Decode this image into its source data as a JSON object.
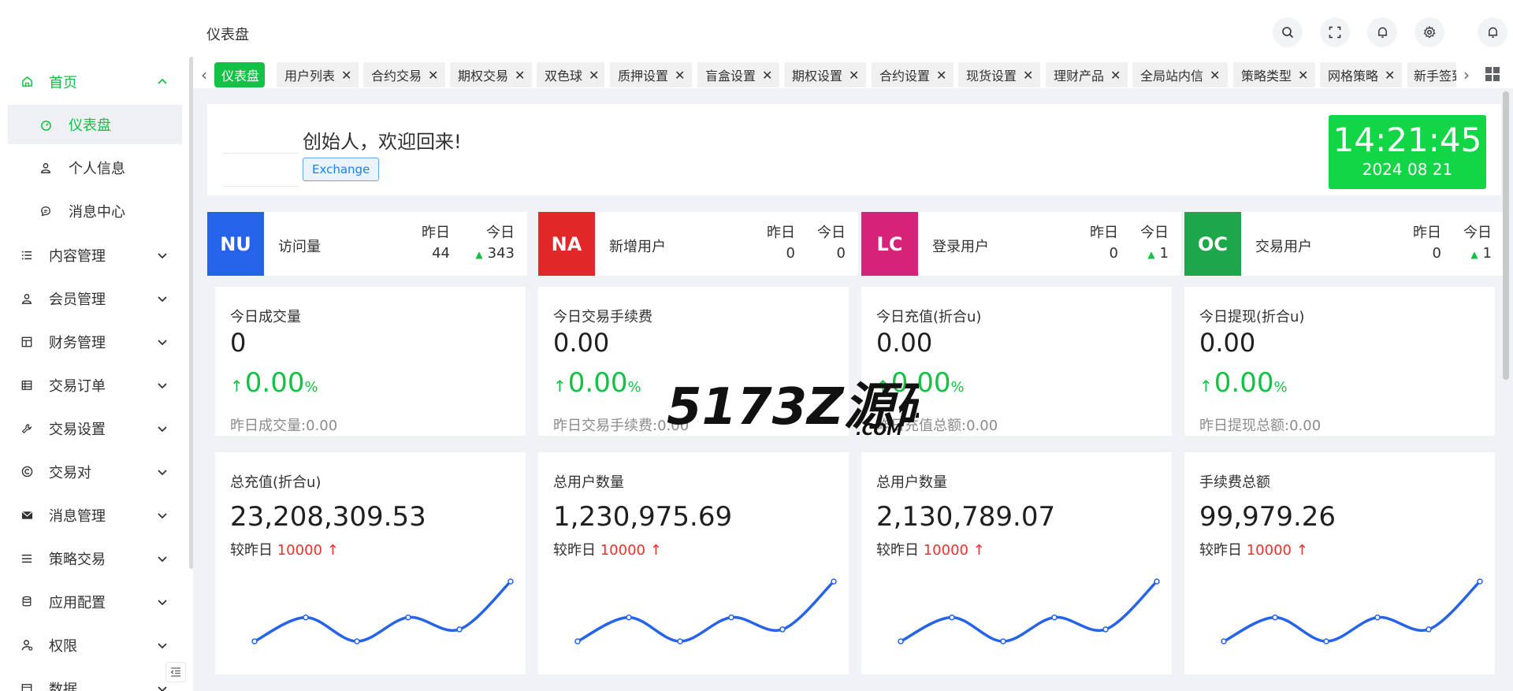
{
  "header": {
    "page_title": "仪表盘"
  },
  "sidebar": {
    "home": "首页",
    "home_children": [
      "仪表盘",
      "个人信息",
      "消息中心"
    ],
    "menus": [
      "内容管理",
      "会员管理",
      "财务管理",
      "交易订单",
      "交易设置",
      "交易对",
      "消息管理",
      "策略交易",
      "应用配置",
      "权限",
      "数据"
    ]
  },
  "tabs": [
    "仪表盘",
    "用户列表",
    "合约交易",
    "期权交易",
    "双色球",
    "质押设置",
    "盲盒设置",
    "期权设置",
    "合约设置",
    "现货设置",
    "理财产品",
    "全局站内信",
    "策略类型",
    "网格策略",
    "新手签到"
  ],
  "welcome": {
    "greeting": "创始人，欢迎回来!",
    "role": "Exchange"
  },
  "clock": {
    "time": "14:21:45",
    "date": "2024 08 21"
  },
  "stats": [
    {
      "code": "NU",
      "name": "访问量",
      "yesterday_label": "昨日",
      "yesterday": "44",
      "today_label": "今日",
      "today": "343",
      "color": "#2563e8"
    },
    {
      "code": "NA",
      "name": "新增用户",
      "yesterday_label": "昨日",
      "yesterday": "0",
      "today_label": "今日",
      "today": "0",
      "color": "#e02828"
    },
    {
      "code": "LC",
      "name": "登录用户",
      "yesterday_label": "昨日",
      "yesterday": "0",
      "today_label": "今日",
      "today": "1",
      "color": "#d6237a"
    },
    {
      "code": "OC",
      "name": "交易用户",
      "yesterday_label": "昨日",
      "yesterday": "0",
      "today_label": "今日",
      "today": "1",
      "color": "#1ea64a"
    }
  ],
  "today_cards": [
    {
      "label": "今日成交量",
      "value": "0",
      "pct": "0.00",
      "unit": "%",
      "footer": "昨日成交量:0.00"
    },
    {
      "label": "今日交易手续费",
      "value": "0.00",
      "pct": "0.00",
      "unit": "%",
      "footer": "昨日交易手续费:0.00"
    },
    {
      "label": "今日充值(折合u)",
      "value": "0.00",
      "pct": "0.00",
      "unit": "%",
      "footer": "昨日充值总额:0.00"
    },
    {
      "label": "今日提现(折合u)",
      "value": "0.00",
      "pct": "0.00",
      "unit": "%",
      "footer": "昨日提现总额:0.00"
    }
  ],
  "total_cards": [
    {
      "label": "总充值(折合u)",
      "value": "23,208,309.53",
      "cmp_label": "较昨日",
      "cmp_value": "10000"
    },
    {
      "label": "总用户数量",
      "value": "1,230,975.69",
      "cmp_label": "较昨日",
      "cmp_value": "10000"
    },
    {
      "label": "总用户数量",
      "value": "2,130,789.07",
      "cmp_label": "较昨日",
      "cmp_value": "10000"
    },
    {
      "label": "手续费总额",
      "value": "99,979.26",
      "cmp_label": "较昨日",
      "cmp_value": "10000"
    }
  ],
  "sparkline": {
    "values": [
      1,
      3,
      1,
      3,
      2,
      6
    ],
    "color": "#2563e8"
  },
  "watermark": {
    "text": "5173Z源码",
    "sub": ".COM"
  },
  "colors": {
    "accent": "#13c244",
    "increase": "#f0302a"
  }
}
